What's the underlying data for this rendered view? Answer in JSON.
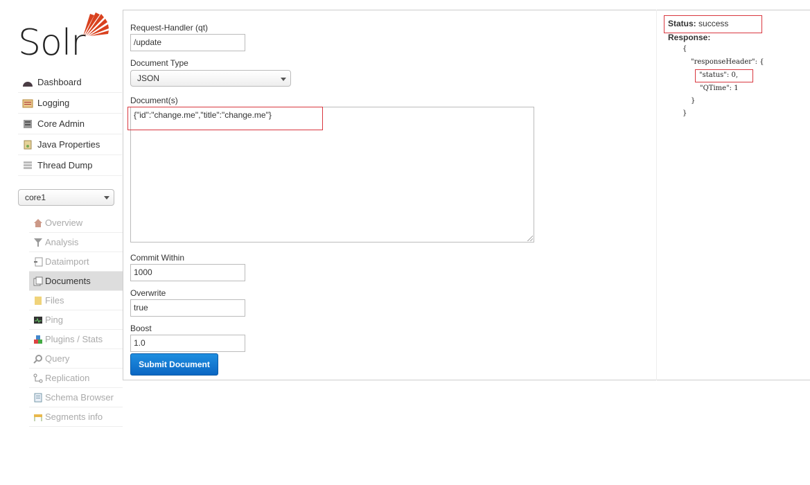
{
  "brand": {
    "logo_text": "Solr",
    "logo_color": "#d9411e"
  },
  "sidebar": {
    "items": [
      {
        "label": "Dashboard",
        "icon": "dashboard-icon"
      },
      {
        "label": "Logging",
        "icon": "logging-icon"
      },
      {
        "label": "Core Admin",
        "icon": "core-admin-icon"
      },
      {
        "label": "Java Properties",
        "icon": "java-properties-icon"
      },
      {
        "label": "Thread Dump",
        "icon": "thread-dump-icon"
      }
    ],
    "core_selector": {
      "value": "core1"
    },
    "core_items": [
      {
        "label": "Overview",
        "icon": "home-icon"
      },
      {
        "label": "Analysis",
        "icon": "funnel-icon"
      },
      {
        "label": "Dataimport",
        "icon": "import-icon"
      },
      {
        "label": "Documents",
        "icon": "documents-icon",
        "active": true
      },
      {
        "label": "Files",
        "icon": "folder-icon"
      },
      {
        "label": "Ping",
        "icon": "ping-icon"
      },
      {
        "label": "Plugins / Stats",
        "icon": "plugins-icon"
      },
      {
        "label": "Query",
        "icon": "magnifier-icon"
      },
      {
        "label": "Replication",
        "icon": "replication-icon"
      },
      {
        "label": "Schema Browser",
        "icon": "schema-icon"
      },
      {
        "label": "Segments info",
        "icon": "segments-icon"
      }
    ]
  },
  "form": {
    "request_handler_label": "Request-Handler (qt)",
    "request_handler_value": "/update",
    "document_type_label": "Document Type",
    "document_type_value": "JSON",
    "documents_label": "Document(s)",
    "documents_value": "{\"id\":\"change.me\",\"title\":\"change.me\"}",
    "commit_within_label": "Commit Within",
    "commit_within_value": "1000",
    "overwrite_label": "Overwrite",
    "overwrite_value": "true",
    "boost_label": "Boost",
    "boost_value": "1.0",
    "submit_label": "Submit Document"
  },
  "response": {
    "status_label": "Status:",
    "status_value": "success",
    "response_label": "Response:",
    "lines": [
      "{",
      "\"responseHeader\": {",
      "\"status\": 0,",
      "\"QTime\": 1",
      "}",
      "}"
    ]
  },
  "colors": {
    "highlight_box": "#d9363e",
    "button": "#0b66c3",
    "active_item_bg": "#dddddd"
  }
}
